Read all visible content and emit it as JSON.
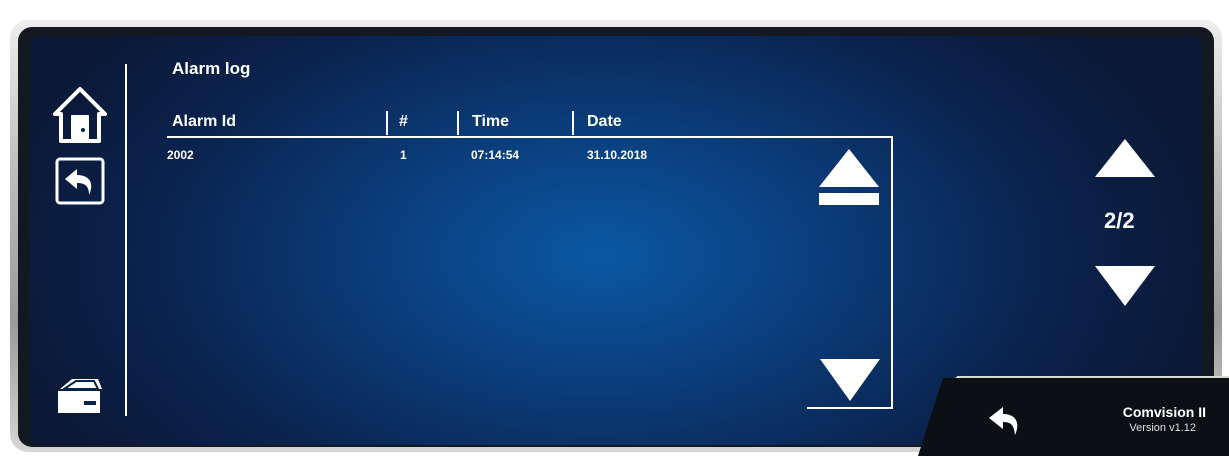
{
  "screen": {
    "title": "Alarm log",
    "page_indicator": "2/2"
  },
  "table": {
    "columns": [
      "Alarm Id",
      "#",
      "Time",
      "Date"
    ],
    "rows": [
      {
        "alarm_id": "2002",
        "count": "1",
        "time": "07:14:54",
        "date": "31.10.2018"
      }
    ]
  },
  "footer": {
    "brand": "Comvision II",
    "version": "Version v1.12"
  },
  "icons": {
    "home": "home-icon",
    "back": "back-icon",
    "service": "toolbox-icon",
    "scroll_top": "scroll-to-top-icon",
    "scroll_down": "scroll-down-icon",
    "page_up": "page-up-icon",
    "page_down": "page-down-icon",
    "footer_back": "footer-back-icon"
  },
  "colors": {
    "screen_center": "#0a58a2",
    "screen_edge": "#0b1836",
    "text": "#ffffff",
    "bezel_dark": "#141820"
  }
}
